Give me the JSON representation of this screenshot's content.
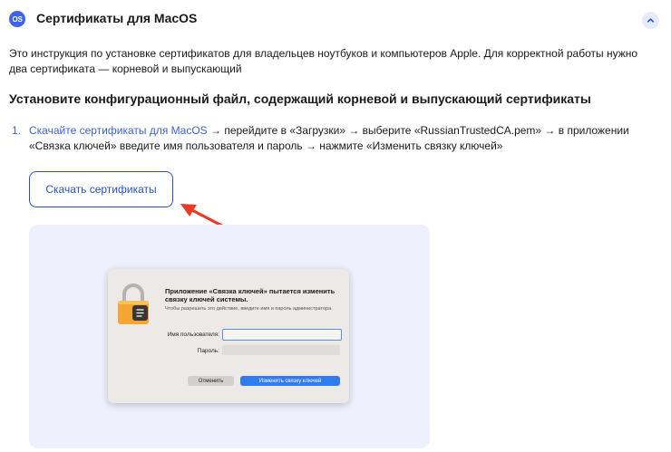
{
  "header": {
    "icon_text": "OS",
    "title": "Сертификаты для MacOS",
    "collapse_icon": "chevron-up-icon"
  },
  "intro": "Это инструкция по установке сертификатов для владельцев ноутбуков и компьютеров Apple. Для корректной работы нужно два сертификата — корневой и выпускающий",
  "section_heading": "Установите конфигурационный файл, содержащий корневой и выпускающий сертификаты",
  "step": {
    "number": "1.",
    "link_text": "Скачайте сертификаты для MacOS",
    "rest_text": " → перейдите в «Загрузки» → выберите «RussianTrustedCA.pem» → в приложении «Связка ключей» введите имя пользователя и пароль → нажмите «Изменить связку ключей»"
  },
  "download_button": "Скачать сертификаты",
  "colors": {
    "accent": "#3c61e0",
    "arrow": "#ea3a25",
    "panel_bg": "#eef0fd"
  },
  "dialog": {
    "title": "Приложение «Связка ключей» пытается изменить связку ключей системы.",
    "subtitle": "Чтобы разрешить это действие, введите имя и пароль администратора.",
    "username_label": "Имя пользователя:",
    "password_label": "Пароль:",
    "cancel": "Отменить",
    "confirm": "Изменить связку ключей"
  }
}
